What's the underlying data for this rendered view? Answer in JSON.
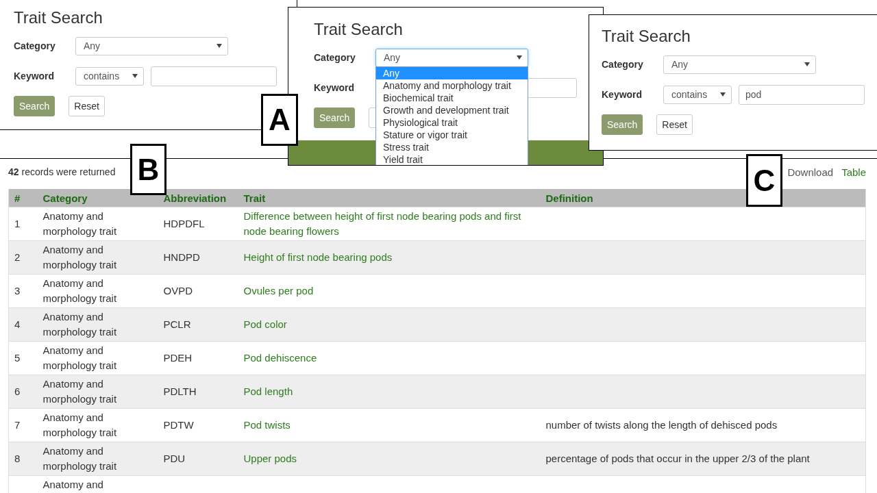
{
  "panels": [
    {
      "title": "Trait Search",
      "category_label": "Category",
      "category_value": "Any",
      "keyword_label": "Keyword",
      "operator_value": "contains",
      "search": "Search",
      "reset": "Reset"
    },
    {
      "title": "Trait Search",
      "category_label": "Category",
      "category_value": "Any",
      "keyword_label": "Keyword",
      "search": "Search",
      "category_dropdown": [
        {
          "label": "Any",
          "selected": true
        },
        {
          "label": "Anatomy and morphology trait",
          "selected": false
        },
        {
          "label": "Biochemical trait",
          "selected": false
        },
        {
          "label": "Growth and development trait",
          "selected": false
        },
        {
          "label": "Physiological trait",
          "selected": false
        },
        {
          "label": "Stature or vigor trait",
          "selected": false
        },
        {
          "label": "Stress trait",
          "selected": false
        },
        {
          "label": "Yield trait",
          "selected": false
        }
      ]
    },
    {
      "title": "Trait Search",
      "category_label": "Category",
      "category_value": "Any",
      "keyword_label": "Keyword",
      "operator_value": "contains",
      "keyword_value": "pod",
      "search": "Search",
      "reset": "Reset"
    }
  ],
  "callouts": [
    "A",
    "B",
    "C"
  ],
  "results": {
    "summary": "**42** records were returned",
    "links": [
      {
        "label": "Download",
        "kind": "plain"
      },
      {
        "label": "Table",
        "kind": "accent"
      }
    ],
    "columns": [
      "#",
      "Category",
      "Abbreviation",
      "Trait",
      "Definition"
    ],
    "rows": [
      {
        "number": "1",
        "category": "Anatomy and morphology trait",
        "abbreviation": "HDPDFL",
        "trait": "Difference between height of first node bearing pods and first node bearing flowers"
      },
      {
        "number": "2",
        "category": "Anatomy and morphology trait",
        "abbreviation": "HNDPD",
        "trait": "Height of first node bearing pods"
      },
      {
        "number": "3",
        "category": "Anatomy and morphology trait",
        "abbreviation": "OVPD",
        "trait": "Ovules per pod"
      },
      {
        "number": "4",
        "category": "Anatomy and morphology trait",
        "abbreviation": "PCLR",
        "trait": "Pod color"
      },
      {
        "number": "5",
        "category": "Anatomy and morphology trait",
        "abbreviation": "PDEH",
        "trait": "Pod dehiscence"
      },
      {
        "number": "6",
        "category": "Anatomy and morphology trait",
        "abbreviation": "PDLTH",
        "trait": "Pod length"
      },
      {
        "number": "7",
        "category": "Anatomy and morphology trait",
        "abbreviation": "PDTW",
        "trait": "Pod twists",
        "definition": "number of twists along the length of dehisced pods"
      },
      {
        "number": "8",
        "category": "Anatomy and morphology trait",
        "abbreviation": "PDU",
        "trait": "Upper pods",
        "definition": "percentage of pods that occur in the upper 2/3 of the plant"
      },
      {
        "category": "Anatomy and"
      }
    ]
  }
}
